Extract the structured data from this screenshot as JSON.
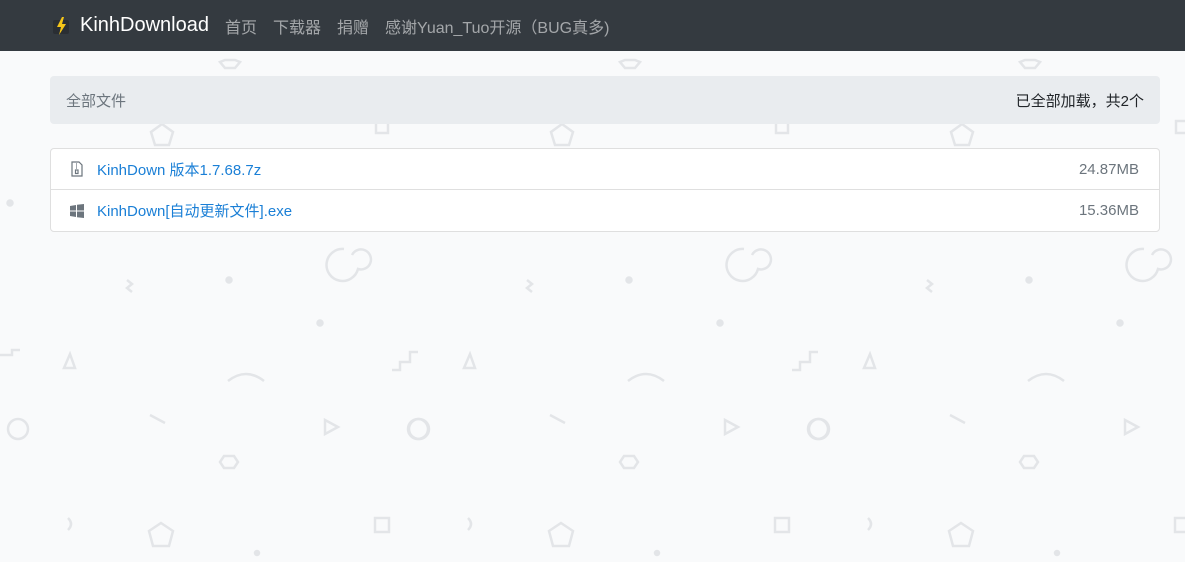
{
  "navbar": {
    "brand": "KinhDownload",
    "brand_icon": "lightning-logo-icon",
    "links": [
      "首页",
      "下载器",
      "捐赠",
      "感谢Yuan_Tuo开源（BUG真多)"
    ]
  },
  "breadcrumb": {
    "root": "全部文件",
    "status": "已全部加载，共2个"
  },
  "files": [
    {
      "name": "KinhDown 版本1.7.68.7z",
      "size": "24.87MB",
      "icon": "archive-file-icon"
    },
    {
      "name": "KinhDown[自动更新文件].exe",
      "size": "15.36MB",
      "icon": "windows-icon"
    }
  ],
  "colors": {
    "navbar_bg": "#343a40",
    "link": "#1a7fd6",
    "breadcrumb_bg": "#e9ecef",
    "page_bg": "#f9fafb"
  }
}
